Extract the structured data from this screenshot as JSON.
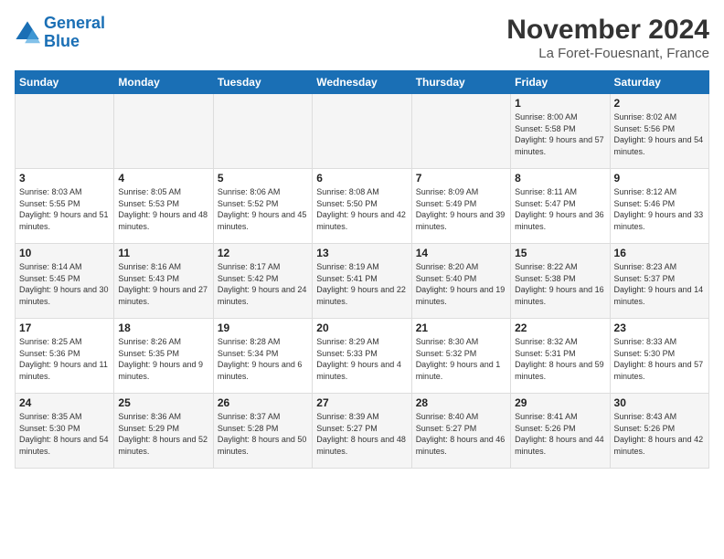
{
  "logo": {
    "line1": "General",
    "line2": "Blue"
  },
  "title": "November 2024",
  "location": "La Foret-Fouesnant, France",
  "days_of_week": [
    "Sunday",
    "Monday",
    "Tuesday",
    "Wednesday",
    "Thursday",
    "Friday",
    "Saturday"
  ],
  "weeks": [
    [
      {
        "day": "",
        "info": ""
      },
      {
        "day": "",
        "info": ""
      },
      {
        "day": "",
        "info": ""
      },
      {
        "day": "",
        "info": ""
      },
      {
        "day": "",
        "info": ""
      },
      {
        "day": "1",
        "info": "Sunrise: 8:00 AM\nSunset: 5:58 PM\nDaylight: 9 hours and 57 minutes."
      },
      {
        "day": "2",
        "info": "Sunrise: 8:02 AM\nSunset: 5:56 PM\nDaylight: 9 hours and 54 minutes."
      }
    ],
    [
      {
        "day": "3",
        "info": "Sunrise: 8:03 AM\nSunset: 5:55 PM\nDaylight: 9 hours and 51 minutes."
      },
      {
        "day": "4",
        "info": "Sunrise: 8:05 AM\nSunset: 5:53 PM\nDaylight: 9 hours and 48 minutes."
      },
      {
        "day": "5",
        "info": "Sunrise: 8:06 AM\nSunset: 5:52 PM\nDaylight: 9 hours and 45 minutes."
      },
      {
        "day": "6",
        "info": "Sunrise: 8:08 AM\nSunset: 5:50 PM\nDaylight: 9 hours and 42 minutes."
      },
      {
        "day": "7",
        "info": "Sunrise: 8:09 AM\nSunset: 5:49 PM\nDaylight: 9 hours and 39 minutes."
      },
      {
        "day": "8",
        "info": "Sunrise: 8:11 AM\nSunset: 5:47 PM\nDaylight: 9 hours and 36 minutes."
      },
      {
        "day": "9",
        "info": "Sunrise: 8:12 AM\nSunset: 5:46 PM\nDaylight: 9 hours and 33 minutes."
      }
    ],
    [
      {
        "day": "10",
        "info": "Sunrise: 8:14 AM\nSunset: 5:45 PM\nDaylight: 9 hours and 30 minutes."
      },
      {
        "day": "11",
        "info": "Sunrise: 8:16 AM\nSunset: 5:43 PM\nDaylight: 9 hours and 27 minutes."
      },
      {
        "day": "12",
        "info": "Sunrise: 8:17 AM\nSunset: 5:42 PM\nDaylight: 9 hours and 24 minutes."
      },
      {
        "day": "13",
        "info": "Sunrise: 8:19 AM\nSunset: 5:41 PM\nDaylight: 9 hours and 22 minutes."
      },
      {
        "day": "14",
        "info": "Sunrise: 8:20 AM\nSunset: 5:40 PM\nDaylight: 9 hours and 19 minutes."
      },
      {
        "day": "15",
        "info": "Sunrise: 8:22 AM\nSunset: 5:38 PM\nDaylight: 9 hours and 16 minutes."
      },
      {
        "day": "16",
        "info": "Sunrise: 8:23 AM\nSunset: 5:37 PM\nDaylight: 9 hours and 14 minutes."
      }
    ],
    [
      {
        "day": "17",
        "info": "Sunrise: 8:25 AM\nSunset: 5:36 PM\nDaylight: 9 hours and 11 minutes."
      },
      {
        "day": "18",
        "info": "Sunrise: 8:26 AM\nSunset: 5:35 PM\nDaylight: 9 hours and 9 minutes."
      },
      {
        "day": "19",
        "info": "Sunrise: 8:28 AM\nSunset: 5:34 PM\nDaylight: 9 hours and 6 minutes."
      },
      {
        "day": "20",
        "info": "Sunrise: 8:29 AM\nSunset: 5:33 PM\nDaylight: 9 hours and 4 minutes."
      },
      {
        "day": "21",
        "info": "Sunrise: 8:30 AM\nSunset: 5:32 PM\nDaylight: 9 hours and 1 minute."
      },
      {
        "day": "22",
        "info": "Sunrise: 8:32 AM\nSunset: 5:31 PM\nDaylight: 8 hours and 59 minutes."
      },
      {
        "day": "23",
        "info": "Sunrise: 8:33 AM\nSunset: 5:30 PM\nDaylight: 8 hours and 57 minutes."
      }
    ],
    [
      {
        "day": "24",
        "info": "Sunrise: 8:35 AM\nSunset: 5:30 PM\nDaylight: 8 hours and 54 minutes."
      },
      {
        "day": "25",
        "info": "Sunrise: 8:36 AM\nSunset: 5:29 PM\nDaylight: 8 hours and 52 minutes."
      },
      {
        "day": "26",
        "info": "Sunrise: 8:37 AM\nSunset: 5:28 PM\nDaylight: 8 hours and 50 minutes."
      },
      {
        "day": "27",
        "info": "Sunrise: 8:39 AM\nSunset: 5:27 PM\nDaylight: 8 hours and 48 minutes."
      },
      {
        "day": "28",
        "info": "Sunrise: 8:40 AM\nSunset: 5:27 PM\nDaylight: 8 hours and 46 minutes."
      },
      {
        "day": "29",
        "info": "Sunrise: 8:41 AM\nSunset: 5:26 PM\nDaylight: 8 hours and 44 minutes."
      },
      {
        "day": "30",
        "info": "Sunrise: 8:43 AM\nSunset: 5:26 PM\nDaylight: 8 hours and 42 minutes."
      }
    ]
  ]
}
